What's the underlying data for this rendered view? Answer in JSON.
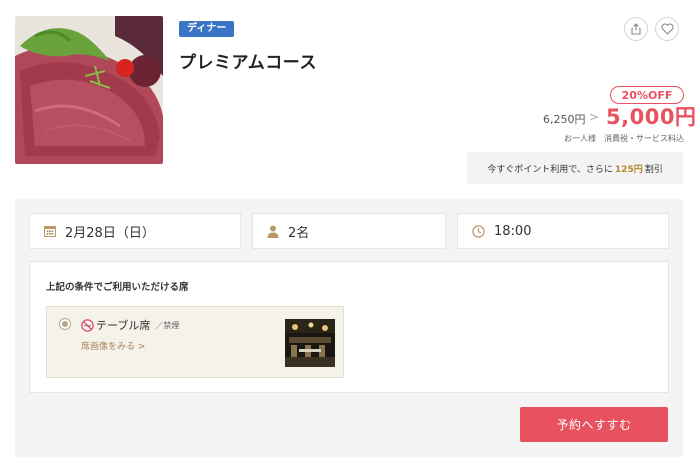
{
  "course": {
    "category_badge": "ディナー",
    "title": "プレミアムコース"
  },
  "actions": {
    "share_icon": "share-icon",
    "favorite_icon": "heart-icon"
  },
  "pricing": {
    "discount_label": "20%OFF",
    "original_price": "6,250円",
    "arrow": ">",
    "discounted_price": "5,000円",
    "note": "お一人様　消費税・サービス料込"
  },
  "points": {
    "prefix": "今すぐポイント利用で、さらに",
    "amount": "125円",
    "suffix": "割引"
  },
  "booking": {
    "date": "2月28日（日）",
    "people": "2名",
    "time": "18:00",
    "date_icon": "calendar-icon",
    "people_icon": "person-icon",
    "time_icon": "clock-icon"
  },
  "seats": {
    "heading": "上記の条件でご利用いただける席",
    "options": [
      {
        "name": "テーブル席",
        "separator": "／禁煙",
        "link": "席画像をみる",
        "link_arrow": ">",
        "selected": true,
        "icon": "no-smoking-icon"
      }
    ]
  },
  "cta": {
    "reserve_label": "予約へすすむ"
  },
  "colors": {
    "accent": "#e8525f",
    "badge_blue": "#3a74c4",
    "gold": "#b58a32",
    "panel_gray": "#f4f4f4"
  }
}
